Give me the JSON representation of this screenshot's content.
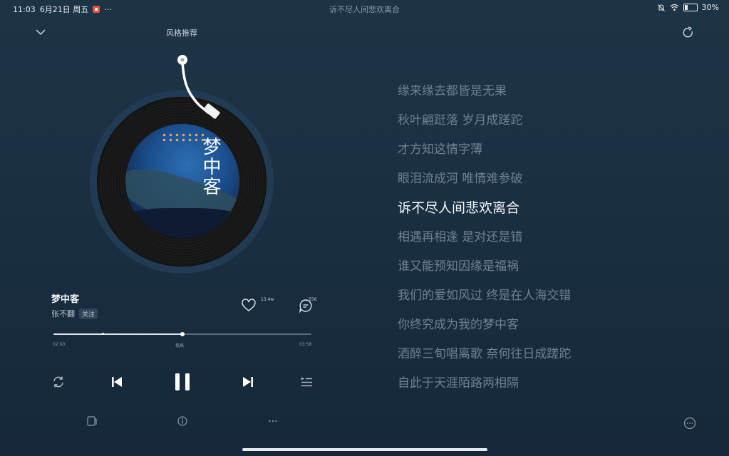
{
  "status_bar": {
    "time": "11:03",
    "date": "6月21日 周五",
    "more": "···",
    "center_text": "诉不尽人间悲欢离合",
    "battery": "30%",
    "battery_level": 0.3
  },
  "header": {
    "title": "风格推荐"
  },
  "album": {
    "cover_text": "梦中客"
  },
  "song": {
    "title": "梦中客",
    "artist": "张不翻",
    "follow_label": "关注",
    "like_count": "13.4w",
    "comment_count": "556"
  },
  "progress": {
    "current": "02:00",
    "middle_label": "极高",
    "total": "03:58",
    "fraction": 0.5
  },
  "lyrics": [
    "缘来缘去都皆是无果",
    "秋叶翩跹落 岁月成蹉跎",
    "才方知这情字薄",
    "眼泪流成河 唯情难参破",
    "诉不尽人间悲欢离合",
    "相遇再相逢 是对还是错",
    "谁又能预知因缘是福祸",
    "我们的爱如风过 终是在人海交错",
    "你终究成为我的梦中客",
    "酒醉三旬唱离歌 奈何往日成蹉跎",
    "自此于天涯陌路两相隔"
  ],
  "active_lyric_index": 4,
  "icons": {
    "collapse": "chevron-down-icon",
    "share": "share-icon",
    "like": "heart-icon",
    "comment": "comment-icon",
    "repeat": "repeat-icon",
    "previous": "previous-icon",
    "pause": "pause-icon",
    "next": "next-icon",
    "playlist": "playlist-icon",
    "lyrics_mode": "lyrics-mode-icon",
    "info": "info-icon",
    "more": "more-icon",
    "lyrics_more": "lyrics-more-icon"
  }
}
